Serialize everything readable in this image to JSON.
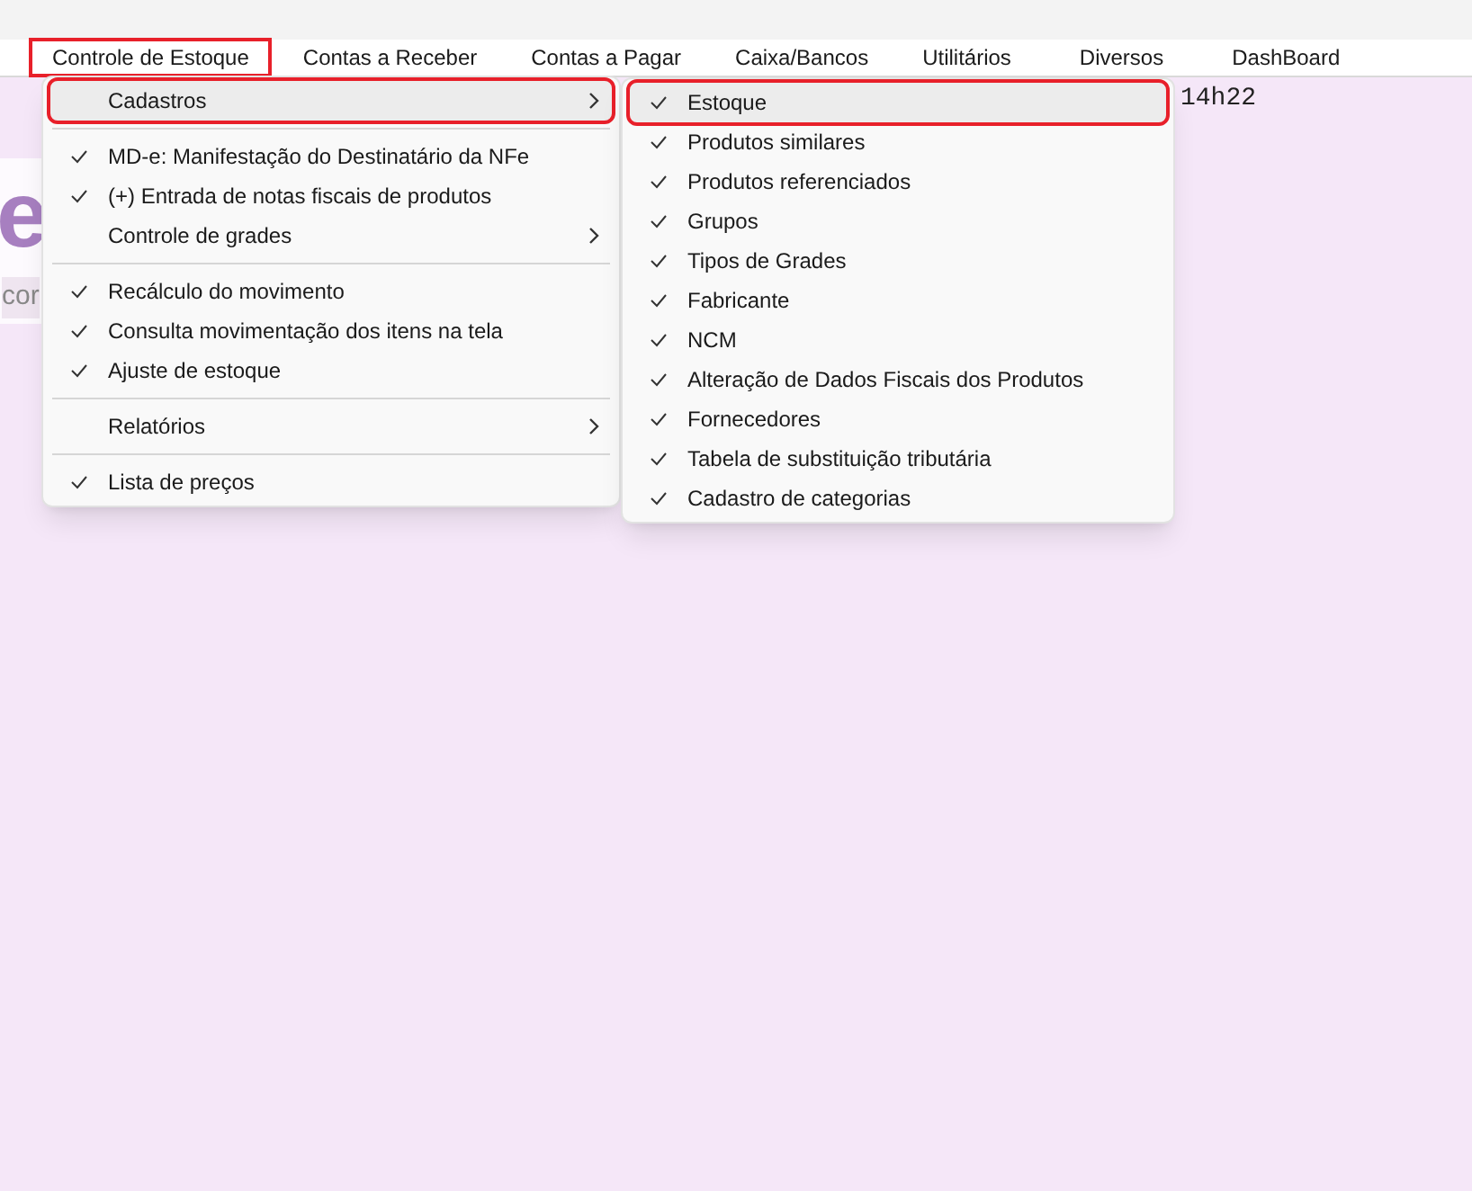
{
  "menu_bar": [
    {
      "label": "Controle de Estoque",
      "highlighted": true
    },
    {
      "label": "Contas a Receber",
      "highlighted": false
    },
    {
      "label": "Contas a Pagar",
      "highlighted": false
    },
    {
      "label": "Caixa/Bancos",
      "highlighted": false
    },
    {
      "label": "Utilitários",
      "highlighted": false
    },
    {
      "label": "Diversos",
      "highlighted": false
    },
    {
      "label": "DashBoard",
      "highlighted": false
    }
  ],
  "background": {
    "logo_text": "e",
    "subtitle": "cor",
    "time": "14h22"
  },
  "menu": [
    {
      "kind": "item",
      "label": "Cadastros",
      "checked": false,
      "submenu": true,
      "selected": true,
      "highlighted": true
    },
    {
      "kind": "separator"
    },
    {
      "kind": "item",
      "label": "MD-e: Manifestação do Destinatário da NFe",
      "checked": true,
      "submenu": false,
      "selected": false,
      "highlighted": false
    },
    {
      "kind": "item",
      "label": "(+) Entrada de notas fiscais de produtos",
      "checked": true,
      "submenu": false,
      "selected": false,
      "highlighted": false
    },
    {
      "kind": "item",
      "label": "Controle de grades",
      "checked": false,
      "submenu": true,
      "selected": false,
      "highlighted": false
    },
    {
      "kind": "separator"
    },
    {
      "kind": "item",
      "label": "Recálculo do movimento",
      "checked": true,
      "submenu": false,
      "selected": false,
      "highlighted": false
    },
    {
      "kind": "item",
      "label": "Consulta movimentação dos itens na tela",
      "checked": true,
      "submenu": false,
      "selected": false,
      "highlighted": false
    },
    {
      "kind": "item",
      "label": "Ajuste de estoque",
      "checked": true,
      "submenu": false,
      "selected": false,
      "highlighted": false
    },
    {
      "kind": "separator"
    },
    {
      "kind": "item",
      "label": "Relatórios",
      "checked": false,
      "submenu": true,
      "selected": false,
      "highlighted": false
    },
    {
      "kind": "separator"
    },
    {
      "kind": "item",
      "label": "Lista de preços",
      "checked": true,
      "submenu": false,
      "selected": false,
      "highlighted": false
    }
  ],
  "submenu": [
    {
      "kind": "item",
      "label": "Estoque",
      "checked": true,
      "submenu": false,
      "selected": true,
      "highlighted": true
    },
    {
      "kind": "item",
      "label": "Produtos similares",
      "checked": true,
      "submenu": false,
      "selected": false,
      "highlighted": false
    },
    {
      "kind": "item",
      "label": "Produtos referenciados",
      "checked": true,
      "submenu": false,
      "selected": false,
      "highlighted": false
    },
    {
      "kind": "item",
      "label": "Grupos",
      "checked": true,
      "submenu": false,
      "selected": false,
      "highlighted": false
    },
    {
      "kind": "item",
      "label": "Tipos de Grades",
      "checked": true,
      "submenu": false,
      "selected": false,
      "highlighted": false
    },
    {
      "kind": "item",
      "label": "Fabricante",
      "checked": true,
      "submenu": false,
      "selected": false,
      "highlighted": false
    },
    {
      "kind": "item",
      "label": "NCM",
      "checked": true,
      "submenu": false,
      "selected": false,
      "highlighted": false
    },
    {
      "kind": "item",
      "label": "Alteração de Dados Fiscais dos Produtos",
      "checked": true,
      "submenu": false,
      "selected": false,
      "highlighted": false
    },
    {
      "kind": "item",
      "label": "Fornecedores",
      "checked": true,
      "submenu": false,
      "selected": false,
      "highlighted": false
    },
    {
      "kind": "item",
      "label": "Tabela de substituição tributária",
      "checked": true,
      "submenu": false,
      "selected": false,
      "highlighted": false
    },
    {
      "kind": "item",
      "label": "Cadastro de categorias",
      "checked": true,
      "submenu": false,
      "selected": false,
      "highlighted": false
    }
  ]
}
